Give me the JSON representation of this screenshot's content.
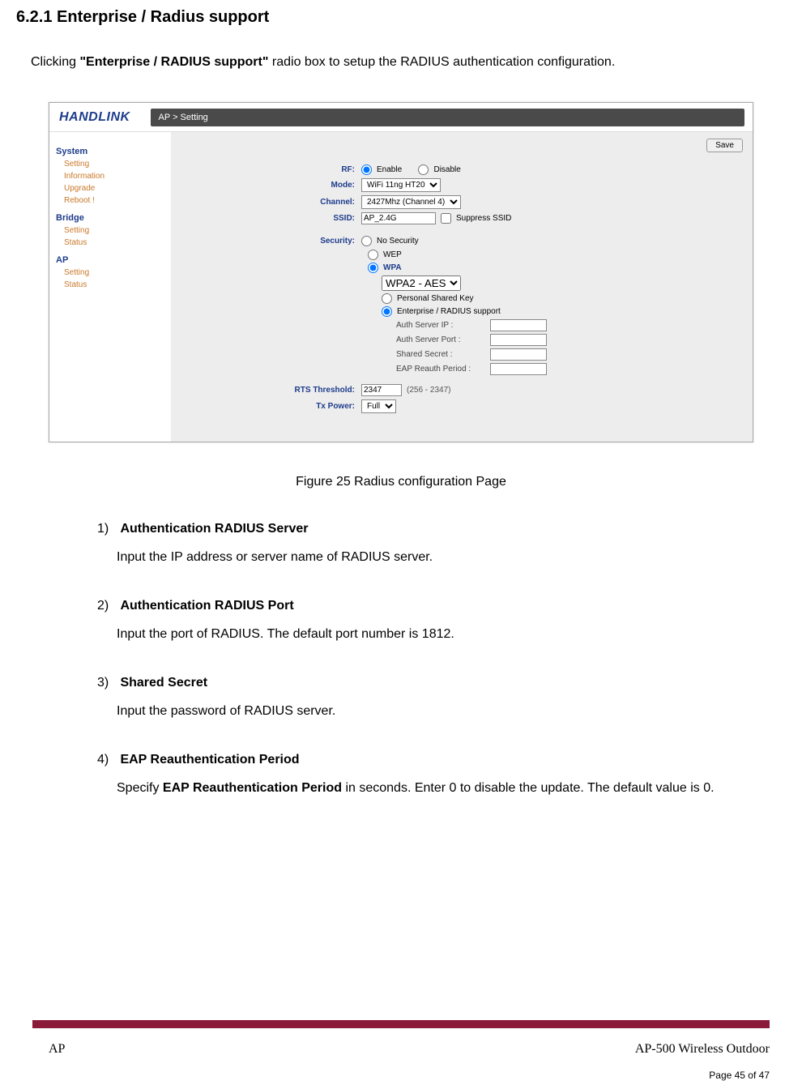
{
  "heading": "6.2.1    Enterprise / Radius support",
  "intro": {
    "prefix": "Clicking ",
    "bold": "\"Enterprise / RADIUS support\"",
    "suffix": " radio box to setup the RADIUS authentication configuration."
  },
  "screenshot": {
    "logo": "HANDLINK",
    "breadcrumb": "AP > Setting",
    "save": "Save",
    "sidebar": {
      "g1": "System",
      "g1i1": "Setting",
      "g1i2": "Information",
      "g1i3": "Upgrade",
      "g1i4": "Reboot !",
      "g2": "Bridge",
      "g2i1": "Setting",
      "g2i2": "Status",
      "g3": "AP",
      "g3i1": "Setting",
      "g3i2": "Status"
    },
    "form": {
      "rf_label": "RF:",
      "rf_enable": "Enable",
      "rf_disable": "Disable",
      "mode_label": "Mode:",
      "mode_value": "WiFi 11ng HT20",
      "channel_label": "Channel:",
      "channel_value": "2427Mhz (Channel 4)",
      "ssid_label": "SSID:",
      "ssid_value": "AP_2.4G",
      "suppress": "Suppress SSID",
      "security_label": "Security:",
      "nosec": "No Security",
      "wep": "WEP",
      "wpa": "WPA",
      "wpa_mode": "WPA2 - AES",
      "psk": "Personal Shared Key",
      "radius": "Enterprise / RADIUS support",
      "auth_ip": "Auth Server IP :",
      "auth_port": "Auth Server Port :",
      "shared_secret": "Shared Secret :",
      "eap": "EAP Reauth Period :",
      "rts_label": "RTS Threshold:",
      "rts_value": "2347",
      "rts_hint": "(256 - 2347)",
      "tx_label": "Tx Power:",
      "tx_value": "Full"
    }
  },
  "figure_caption": "Figure 25    Radius configuration Page",
  "items": [
    {
      "num": "1)",
      "title": "Authentication RADIUS Server",
      "desc": "Input the IP address or server name of RADIUS server."
    },
    {
      "num": "2)",
      "title": "Authentication RADIUS Port",
      "desc": "Input the port of RADIUS. The default port number is 1812."
    },
    {
      "num": "3)",
      "title": "Shared Secret",
      "desc": "Input the password of RADIUS server."
    },
    {
      "num": "4)",
      "title": "EAP Reauthentication Period",
      "desc_pre": "Specify ",
      "desc_bold": "EAP Reauthentication Period",
      "desc_post": " in seconds. Enter 0 to disable the update. The default value is 0."
    }
  ],
  "footer": {
    "left": "AP",
    "right": "AP-500    Wireless  Outdoor",
    "page": "Page 45 of 47"
  }
}
